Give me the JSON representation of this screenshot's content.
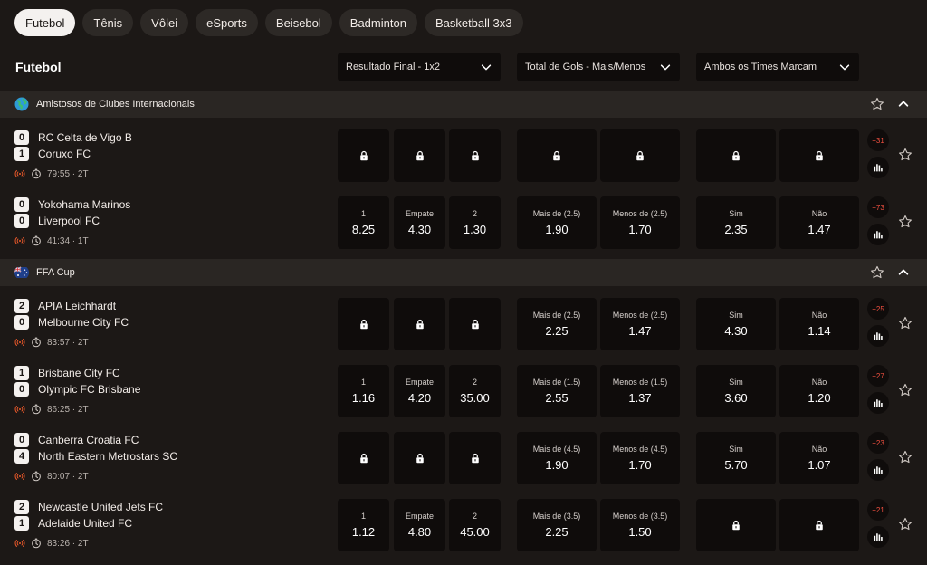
{
  "tabs": [
    "Futebol",
    "Tênis",
    "Vôlei",
    "eSports",
    "Beisebol",
    "Badminton",
    "Basketball 3x3"
  ],
  "active_tab": 0,
  "page_title": "Futebol",
  "markets": [
    "Resultado Final - 1x2",
    "Total de Gols - Mais/Menos",
    "Ambos os Times Marcam"
  ],
  "icons": {
    "chevron": "chevron-down-icon",
    "lock": "lock-icon",
    "star": "star-icon",
    "collapse": "chevron-up-icon",
    "live": "live-broadcast-icon",
    "clock": "clock-icon",
    "stats": "bar-chart-icon"
  },
  "colors": {
    "background": "#1c1816",
    "panel": "#0f0c0b",
    "league_bar": "#2a2623",
    "accent_red": "#f05040",
    "live_orange": "#e8582a"
  },
  "leagues": [
    {
      "name": "Amistosos de Clubes Internacionais",
      "icon": "globe-icon",
      "matches": [
        {
          "home": "RC Celta de Vigo B",
          "away": "Coruxo FC",
          "home_score": "0",
          "away_score": "1",
          "time": "79:55",
          "period": "2T",
          "more": "+31",
          "odds_1x2": [
            null,
            null,
            null
          ],
          "odds_total": [
            null,
            null
          ],
          "odds_btts": [
            null,
            null
          ]
        },
        {
          "home": "Yokohama Marinos",
          "away": "Liverpool FC",
          "home_score": "0",
          "away_score": "0",
          "time": "41:34",
          "period": "1T",
          "more": "+73",
          "odds_1x2": [
            {
              "label": "1",
              "value": "8.25"
            },
            {
              "label": "Empate",
              "value": "4.30"
            },
            {
              "label": "2",
              "value": "1.30"
            }
          ],
          "odds_total": [
            {
              "label": "Mais de (2.5)",
              "value": "1.90"
            },
            {
              "label": "Menos de (2.5)",
              "value": "1.70"
            }
          ],
          "odds_btts": [
            {
              "label": "Sim",
              "value": "2.35"
            },
            {
              "label": "Não",
              "value": "1.47"
            }
          ]
        }
      ]
    },
    {
      "name": "FFA Cup",
      "icon": "australia-flag-icon",
      "matches": [
        {
          "home": "APIA Leichhardt",
          "away": "Melbourne City FC",
          "home_score": "2",
          "away_score": "0",
          "time": "83:57",
          "period": "2T",
          "more": "+25",
          "odds_1x2": [
            null,
            null,
            null
          ],
          "odds_total": [
            {
              "label": "Mais de (2.5)",
              "value": "2.25"
            },
            {
              "label": "Menos de (2.5)",
              "value": "1.47"
            }
          ],
          "odds_btts": [
            {
              "label": "Sim",
              "value": "4.30"
            },
            {
              "label": "Não",
              "value": "1.14"
            }
          ]
        },
        {
          "home": "Brisbane City FC",
          "away": "Olympic FC Brisbane",
          "home_score": "1",
          "away_score": "0",
          "time": "86:25",
          "period": "2T",
          "more": "+27",
          "odds_1x2": [
            {
              "label": "1",
              "value": "1.16"
            },
            {
              "label": "Empate",
              "value": "4.20"
            },
            {
              "label": "2",
              "value": "35.00"
            }
          ],
          "odds_total": [
            {
              "label": "Mais de (1.5)",
              "value": "2.55"
            },
            {
              "label": "Menos de (1.5)",
              "value": "1.37"
            }
          ],
          "odds_btts": [
            {
              "label": "Sim",
              "value": "3.60"
            },
            {
              "label": "Não",
              "value": "1.20"
            }
          ]
        },
        {
          "home": "Canberra Croatia FC",
          "away": "North Eastern Metrostars SC",
          "home_score": "0",
          "away_score": "4",
          "time": "80:07",
          "period": "2T",
          "more": "+23",
          "odds_1x2": [
            null,
            null,
            null
          ],
          "odds_total": [
            {
              "label": "Mais de (4.5)",
              "value": "1.90"
            },
            {
              "label": "Menos de (4.5)",
              "value": "1.70"
            }
          ],
          "odds_btts": [
            {
              "label": "Sim",
              "value": "5.70"
            },
            {
              "label": "Não",
              "value": "1.07"
            }
          ]
        },
        {
          "home": "Newcastle United Jets FC",
          "away": "Adelaide United FC",
          "home_score": "2",
          "away_score": "1",
          "time": "83:26",
          "period": "2T",
          "more": "+21",
          "odds_1x2": [
            {
              "label": "1",
              "value": "1.12"
            },
            {
              "label": "Empate",
              "value": "4.80"
            },
            {
              "label": "2",
              "value": "45.00"
            }
          ],
          "odds_total": [
            {
              "label": "Mais de (3.5)",
              "value": "2.25"
            },
            {
              "label": "Menos de (3.5)",
              "value": "1.50"
            }
          ],
          "odds_btts": [
            null,
            null
          ]
        }
      ]
    }
  ]
}
